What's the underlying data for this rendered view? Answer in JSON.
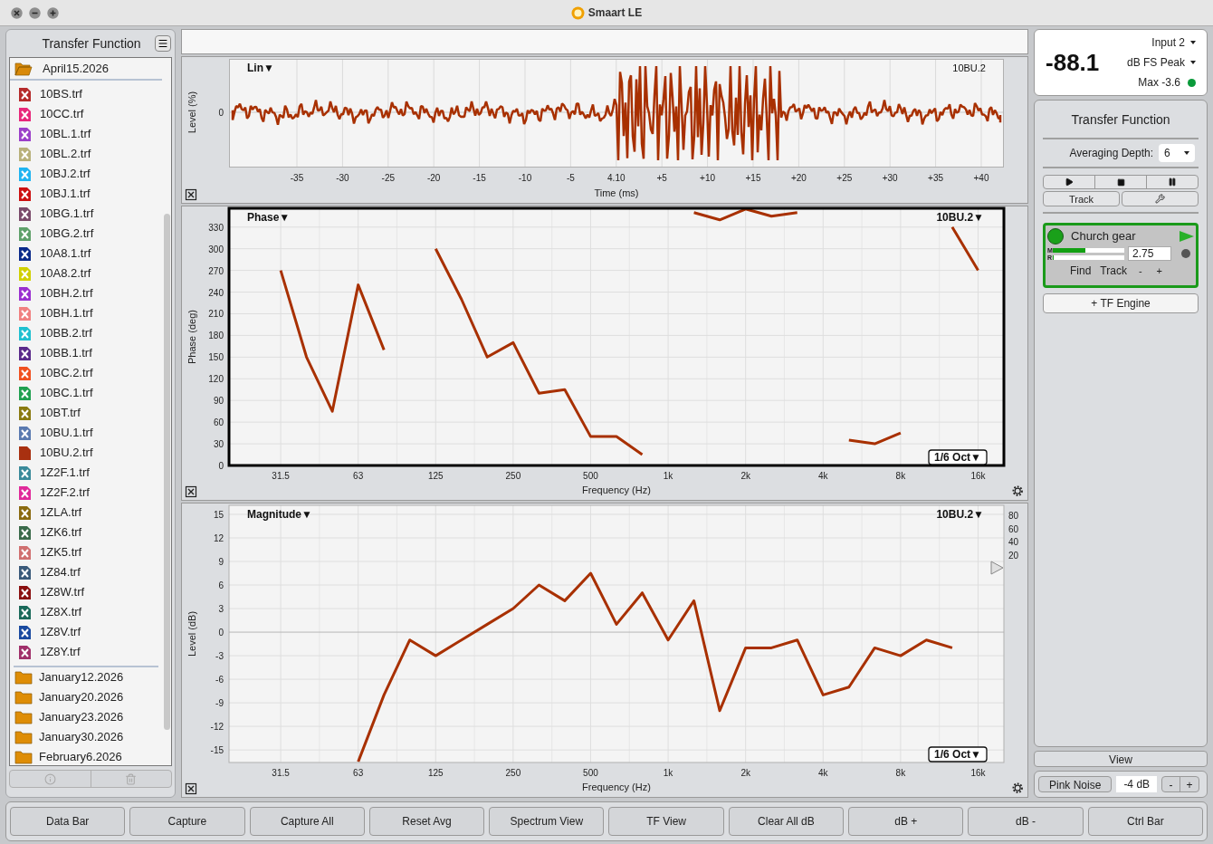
{
  "window": {
    "title": "Smaart LE"
  },
  "sidebar": {
    "title": "Transfer Function",
    "folders": [
      {
        "label": "April15.2026",
        "expanded": true,
        "children": [
          {
            "label": "10BS.trf",
            "color": "#b52a2a",
            "active": false
          },
          {
            "label": "10CC.trf",
            "color": "#e8287a",
            "active": false
          },
          {
            "label": "10BL.1.trf",
            "color": "#9b3fc9",
            "active": false
          },
          {
            "label": "10BL.2.trf",
            "color": "#b8b07a",
            "active": false
          },
          {
            "label": "10BJ.2.trf",
            "color": "#1fb4f0",
            "active": false
          },
          {
            "label": "10BJ.1.trf",
            "color": "#cc1010",
            "active": false
          },
          {
            "label": "10BG.1.trf",
            "color": "#7a4a6a",
            "active": false
          },
          {
            "label": "10BG.2.trf",
            "color": "#5fa06a",
            "active": false
          },
          {
            "label": "10A8.1.trf",
            "color": "#0a2a8a",
            "active": false
          },
          {
            "label": "10A8.2.trf",
            "color": "#d0d000",
            "active": false
          },
          {
            "label": "10BH.2.trf",
            "color": "#9a30d0",
            "active": false
          },
          {
            "label": "10BH.1.trf",
            "color": "#f08080",
            "active": false
          },
          {
            "label": "10BB.2.trf",
            "color": "#20c0d0",
            "active": false
          },
          {
            "label": "10BB.1.trf",
            "color": "#5a2a8a",
            "active": false
          },
          {
            "label": "10BC.2.trf",
            "color": "#f05020",
            "active": false
          },
          {
            "label": "10BC.1.trf",
            "color": "#20a050",
            "active": false
          },
          {
            "label": "10BT.trf",
            "color": "#8a7a10",
            "active": false
          },
          {
            "label": "10BU.1.trf",
            "color": "#5a7ab0",
            "active": false
          },
          {
            "label": "10BU.2.trf",
            "color": "#a83010",
            "active": true
          },
          {
            "label": "1Z2F.1.trf",
            "color": "#3a8a9a",
            "active": false
          },
          {
            "label": "1Z2F.2.trf",
            "color": "#e02a9a",
            "active": false
          },
          {
            "label": "1ZLA.trf",
            "color": "#8a6a10",
            "active": false
          },
          {
            "label": "1ZK6.trf",
            "color": "#3a6a4a",
            "active": false
          },
          {
            "label": "1ZK5.trf",
            "color": "#d07070",
            "active": false
          },
          {
            "label": "1Z84.trf",
            "color": "#3a5a7a",
            "active": false
          },
          {
            "label": "1Z8W.trf",
            "color": "#8a1010",
            "active": false
          },
          {
            "label": "1Z8X.trf",
            "color": "#1a6a5a",
            "active": false
          },
          {
            "label": "1Z8V.trf",
            "color": "#1a4aa0",
            "active": false
          },
          {
            "label": "1Z8Y.trf",
            "color": "#a0306a",
            "active": false
          }
        ]
      },
      {
        "label": "January12.2026",
        "expanded": false
      },
      {
        "label": "January20.2026",
        "expanded": false
      },
      {
        "label": "January23.2026",
        "expanded": false
      },
      {
        "label": "January30.2026",
        "expanded": false
      },
      {
        "label": "February6.2026",
        "expanded": false
      }
    ]
  },
  "plots": [
    {
      "kind": "time",
      "mode": "Lin▼",
      "trace": "10BU.2",
      "ylabel": "Level (%)",
      "ytick": "0",
      "xlabel": "Time (ms)",
      "x_tick_labels": [
        "-35",
        "-30",
        "-25",
        "-20",
        "-15",
        "-10",
        "-5",
        "4.10",
        "+5",
        "+10",
        "+15",
        "+20",
        "+25",
        "+30",
        "+35",
        "+40"
      ]
    },
    {
      "kind": "phase",
      "selected": true,
      "mode": "Phase▼",
      "trace": "10BU.2▼",
      "smoothing": "1/6 Oct▼",
      "chart_data": {
        "type": "line",
        "xlabel": "Frequency (Hz)",
        "ylabel": "Phase (deg)",
        "categories": [
          null,
          null,
          "31.5",
          null,
          null,
          "63",
          null,
          null,
          "125",
          null,
          null,
          "250",
          null,
          null,
          "500",
          null,
          null,
          "1k",
          null,
          null,
          "2k",
          null,
          null,
          "4k",
          null,
          null,
          "8k",
          null,
          null,
          "16k",
          null
        ],
        "grid": true,
        "series": [
          {
            "color": "#a83000",
            "values": [
              null,
              null,
              270,
              150,
              75,
              250,
              160,
              null,
              300,
              230,
              150,
              170,
              100,
              105,
              40,
              40,
              15,
              null,
              350,
              340,
              355,
              345,
              350,
              null,
              35,
              30,
              45,
              null,
              330,
              270,
              null
            ]
          }
        ],
        "ylim": [
          0,
          356
        ],
        "yticks": [
          0,
          30,
          60,
          90,
          120,
          150,
          180,
          210,
          240,
          270,
          300,
          330
        ]
      }
    },
    {
      "kind": "magnitude",
      "selected": false,
      "mode": "Magnitude▼",
      "trace": "10BU.2▼",
      "smoothing": "1/6 Oct▼",
      "coherence_ticks": [
        "80",
        "60",
        "40",
        "20"
      ],
      "chart_data": {
        "type": "line",
        "xlabel": "Frequency (Hz)",
        "ylabel": "Level (dB)",
        "categories": [
          null,
          null,
          "31.5",
          null,
          null,
          "63",
          null,
          null,
          "125",
          null,
          null,
          "250",
          null,
          null,
          "500",
          null,
          null,
          "1k",
          null,
          null,
          "2k",
          null,
          null,
          "4k",
          null,
          null,
          "8k",
          null,
          null,
          "16k",
          null
        ],
        "series": [
          {
            "color": "#a83000",
            "values": [
              null,
              null,
              null,
              null,
              null,
              -16.5,
              -8,
              -1,
              -3,
              -1,
              1,
              3,
              6,
              4,
              7.5,
              1,
              5,
              -1,
              4,
              -10,
              -2,
              -2,
              -1,
              -8,
              -7,
              -2,
              -3,
              -1,
              -2,
              null,
              null
            ]
          }
        ],
        "grid": true,
        "ylim": [
          -16.6,
          16.15
        ],
        "yticks": [
          -15,
          -12,
          -9,
          -6,
          -3,
          0,
          3,
          6,
          9,
          12,
          15
        ]
      }
    }
  ],
  "meter": {
    "value": "-88.1",
    "input": "Input 2",
    "scale": "dB FS Peak",
    "max": "Max -3.6",
    "peak_ok": true
  },
  "tf_panel": {
    "title": "Transfer Function",
    "averaging_label": "Averaging Depth:",
    "averaging_value": "6",
    "track_button": "Track",
    "engine": {
      "name": "Church gear",
      "running": true,
      "armed": false,
      "meters": [
        {
          "label": "M",
          "level": 0.45
        },
        {
          "label": "R",
          "level": 0
        }
      ],
      "delay": "2.75",
      "actions": [
        "Find",
        "Track",
        "-",
        "+"
      ]
    },
    "add_engine": "+ TF Engine"
  },
  "view_button": "View",
  "generator": {
    "label": "Pink Noise",
    "level": "-4 dB",
    "steps": [
      "-",
      "+"
    ]
  },
  "toolbar_buttons": [
    "Data Bar",
    "Capture",
    "Capture All",
    "Reset Avg",
    "Spectrum View",
    "TF View",
    "Clear All dB",
    "dB +",
    "dB -",
    "Ctrl Bar"
  ]
}
